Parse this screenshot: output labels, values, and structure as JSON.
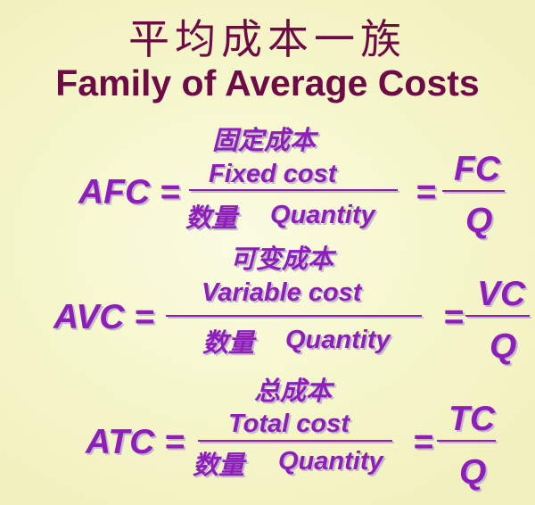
{
  "title": {
    "cn": "平均成本一族",
    "en": "Family of Average Costs"
  },
  "afc": {
    "label": "AFC =",
    "numerator_cn": "固定成本",
    "numerator_en": "Fixed cost",
    "denominator_cn": "数量",
    "denominator_en": "Quantity",
    "equals": "=",
    "short_num": "FC",
    "short_den": "Q"
  },
  "avc": {
    "label": "AVC =",
    "numerator_cn": "可变成本",
    "numerator_en": "Variable cost",
    "denominator_cn": "数量",
    "denominator_en": "Quantity",
    "equals": "=",
    "short_num": "VC",
    "short_den": "Q"
  },
  "atc": {
    "label": "ATC =",
    "numerator_cn": "总成本",
    "numerator_en": "Total cost",
    "denominator_cn": "数量",
    "denominator_en": "Quantity",
    "equals": "=",
    "short_num": "TC",
    "short_den": "Q"
  },
  "colors": {
    "title": "#6e0a45",
    "formula": "#8f1dbc",
    "background": "#f7f7cf"
  }
}
